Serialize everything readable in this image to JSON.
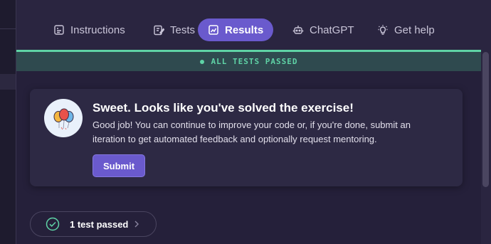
{
  "tabs": [
    {
      "label": "Instructions",
      "icon": "instructions-icon",
      "active": false
    },
    {
      "label": "Tests",
      "icon": "tests-icon",
      "active": false
    },
    {
      "label": "Results",
      "icon": "results-icon",
      "active": true
    },
    {
      "label": "ChatGPT",
      "icon": "robot-icon",
      "active": false
    },
    {
      "label": "Get help",
      "icon": "lightbulb-icon",
      "active": false
    }
  ],
  "status": {
    "text": "ALL TESTS PASSED",
    "color": "#5fd3a6"
  },
  "result_card": {
    "title": "Sweet. Looks like you've solved the exercise!",
    "body_line1": "Good job! You can continue to improve your code or, if you're done, submit an",
    "body_line2": "iteration to get automated feedback and optionally request mentoring.",
    "submit_label": "Submit",
    "icon": "balloons-icon"
  },
  "test_summary": {
    "label": "1 test passed",
    "icon": "check-circle-icon"
  },
  "colors": {
    "accent": "#6a5acd",
    "success": "#5fd3a6",
    "background": "#25203a"
  }
}
